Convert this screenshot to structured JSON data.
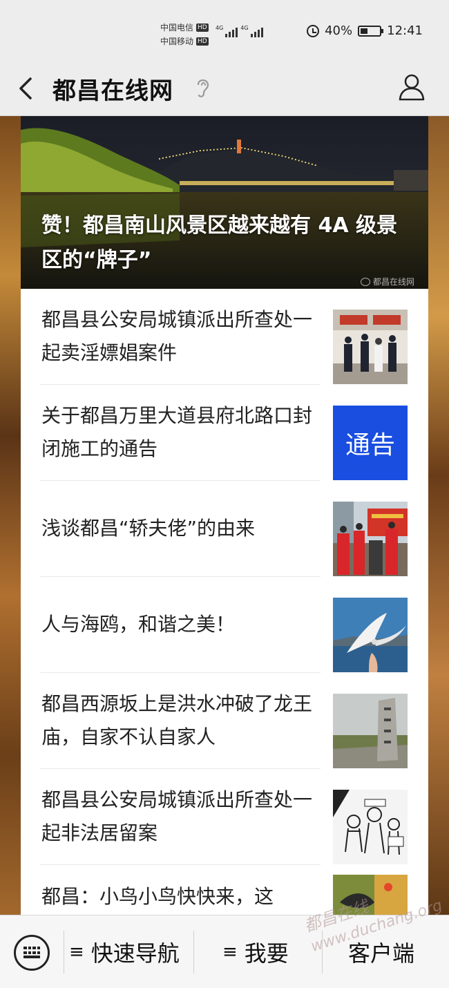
{
  "status_bar": {
    "carrier_1": "中国电信",
    "carrier_2": "中国移动",
    "hd_badge": "HD",
    "network": "4G",
    "battery_text": "40%",
    "battery_level": 0.4,
    "time": "12:41"
  },
  "header": {
    "title": "都昌在线网"
  },
  "hero": {
    "title": "赞！都昌南山风景区越来越有 4A 级景区的“牌子”",
    "watermark": "都昌在线网"
  },
  "articles": [
    {
      "title": "都昌县公安局城镇派出所查处一起卖淫嫖娼案件",
      "thumb": "police-photo"
    },
    {
      "title": "关于都昌万里大道县府北路口封闭施工的通告",
      "thumb": "notice-card",
      "thumb_text": "通告",
      "thumb_color": "#1a4ee0"
    },
    {
      "title": "浅谈都昌“轿夫佬”的由来",
      "thumb": "sedan-photo"
    },
    {
      "title": "人与海鸥，和谐之美！",
      "thumb": "seagull-photo"
    },
    {
      "title": "都昌西源坂上是洪水冲破了龙王庙，自家不认自家人",
      "thumb": "stone-photo"
    },
    {
      "title": "都昌县公安局城镇派出所查处一起非法居留案",
      "thumb": "cartoon-image"
    },
    {
      "title": "都昌：小鸟小鸟快快来，这",
      "thumb": "bird-photo"
    }
  ],
  "bottom_nav": {
    "quick_nav": "快速导航",
    "want": "我要",
    "client": "客户端",
    "menu_glyph": "≡"
  },
  "site_watermark": {
    "text": "都昌在线",
    "url": "www.duchang.org"
  }
}
